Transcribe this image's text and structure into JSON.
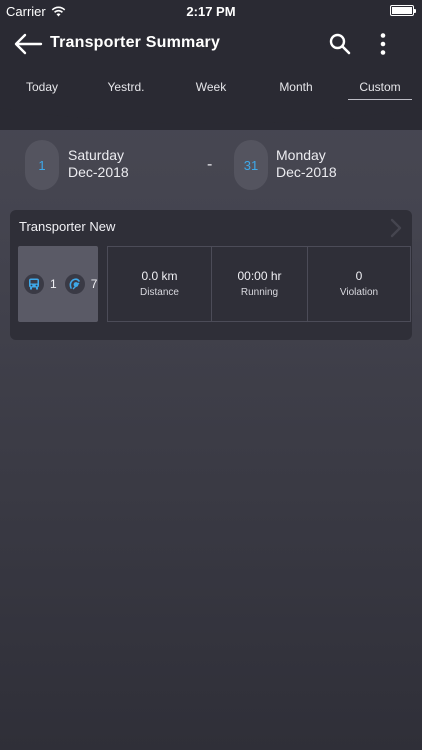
{
  "status_bar": {
    "carrier": "Carrier",
    "time": "2:17 PM"
  },
  "header": {
    "title": "Transporter Summary",
    "back_icon": "arrow-left-icon",
    "search_icon": "search-icon",
    "more_icon": "more-vertical-icon"
  },
  "tabs": [
    {
      "label": "Today",
      "active": false
    },
    {
      "label": "Yestrd.",
      "active": false
    },
    {
      "label": "Week",
      "active": false
    },
    {
      "label": "Month",
      "active": false
    },
    {
      "label": "Custom",
      "active": true
    }
  ],
  "date_range": {
    "from": {
      "day": "1",
      "weekday": "Saturday",
      "month_year": "Dec-2018"
    },
    "separator": "-",
    "to": {
      "day": "31",
      "weekday": "Monday",
      "month_year": "Dec-2018"
    }
  },
  "card": {
    "title": "Transporter New",
    "vehicles": {
      "bus_count": "1",
      "other_count": "7"
    },
    "stats": [
      {
        "value": "0.0 km",
        "label": "Distance"
      },
      {
        "value": "00:00 hr",
        "label": "Running"
      },
      {
        "value": "0",
        "label": "Violation"
      }
    ]
  },
  "colors": {
    "accent": "#3ea8e8",
    "header_bg": "#2a2a33",
    "card_bg": "#2f2f38"
  }
}
